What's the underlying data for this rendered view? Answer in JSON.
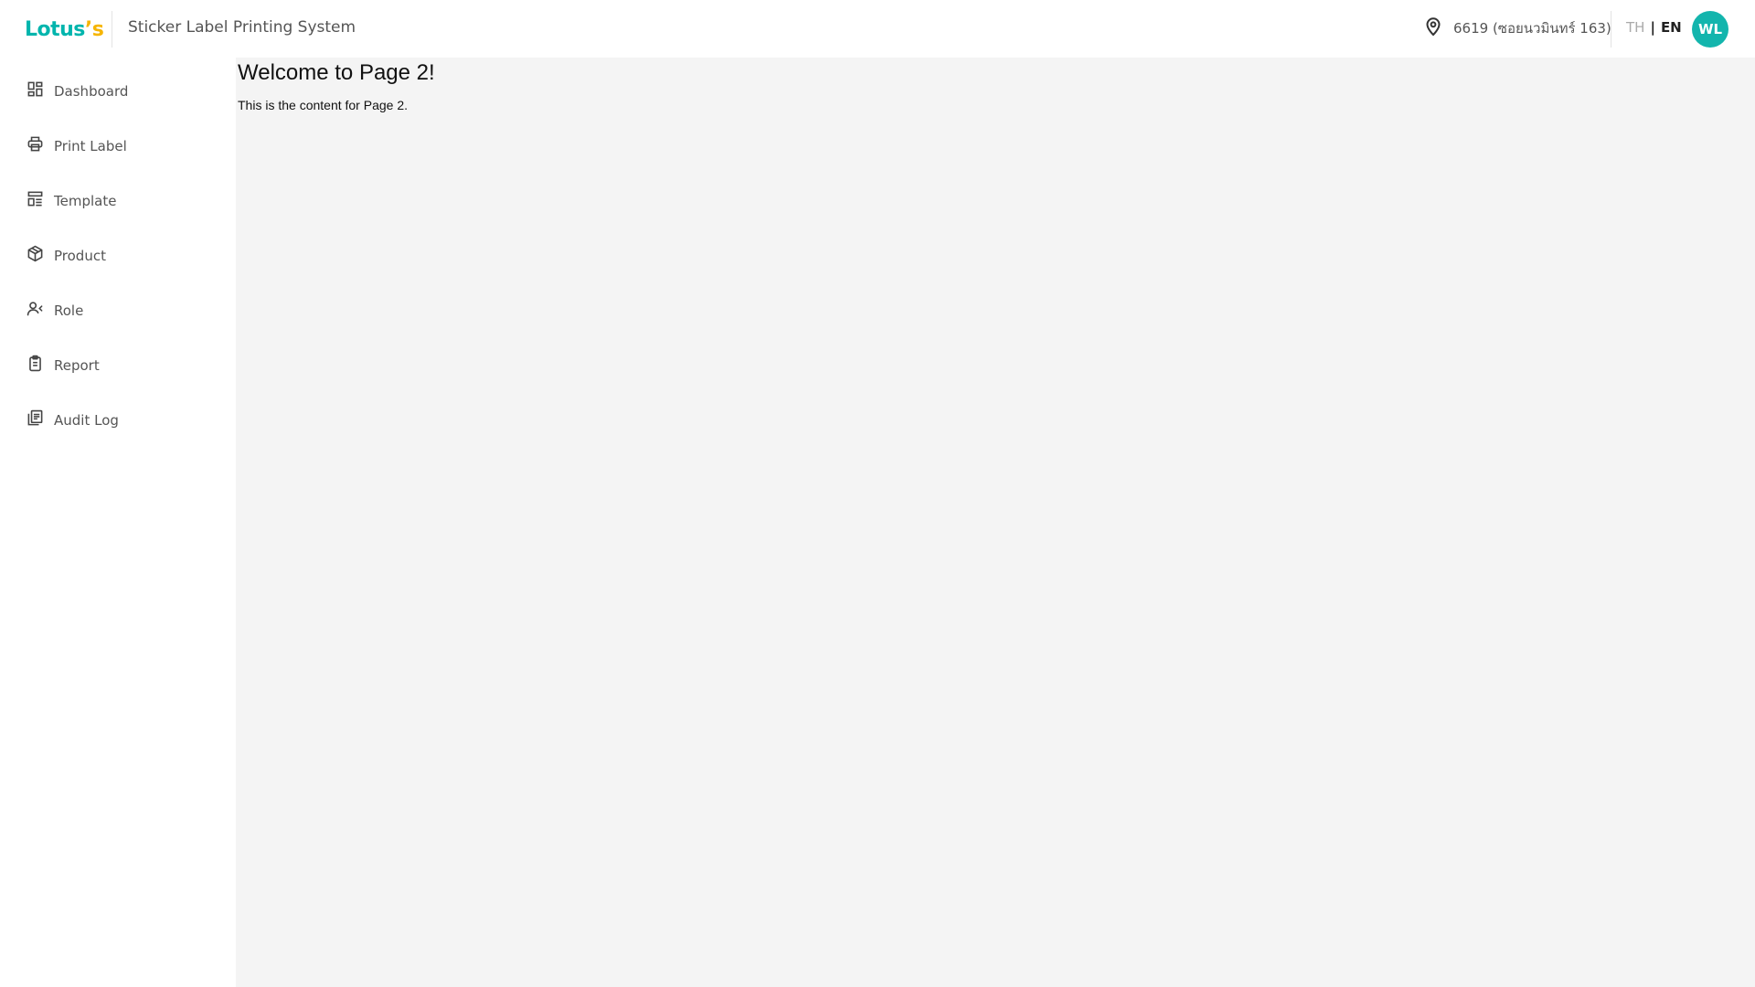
{
  "header": {
    "logo_main": "Lotus",
    "logo_accent": "’s",
    "app_title": "Sticker Label Printing System",
    "store": "6619 (ซอยนวมินทร์ 163)",
    "lang": {
      "th": "TH",
      "separator": "|",
      "en": "EN",
      "active": "EN"
    },
    "avatar_initials": "WL"
  },
  "sidebar": {
    "items": [
      {
        "label": "Dashboard",
        "icon": "dashboard-icon"
      },
      {
        "label": "Print Label",
        "icon": "printer-icon"
      },
      {
        "label": "Template",
        "icon": "template-icon"
      },
      {
        "label": "Product",
        "icon": "box-icon"
      },
      {
        "label": "Role",
        "icon": "user-role-icon"
      },
      {
        "label": "Report",
        "icon": "clipboard-icon"
      },
      {
        "label": "Audit Log",
        "icon": "document-icon"
      }
    ]
  },
  "main": {
    "title": "Welcome to Page 2!",
    "content": "This is the content for Page 2."
  },
  "colors": {
    "brand_teal": "#00b5ad",
    "brand_yellow": "#f6b500",
    "avatar_bg": "#13b5ad",
    "content_bg": "#f4f4f4"
  }
}
